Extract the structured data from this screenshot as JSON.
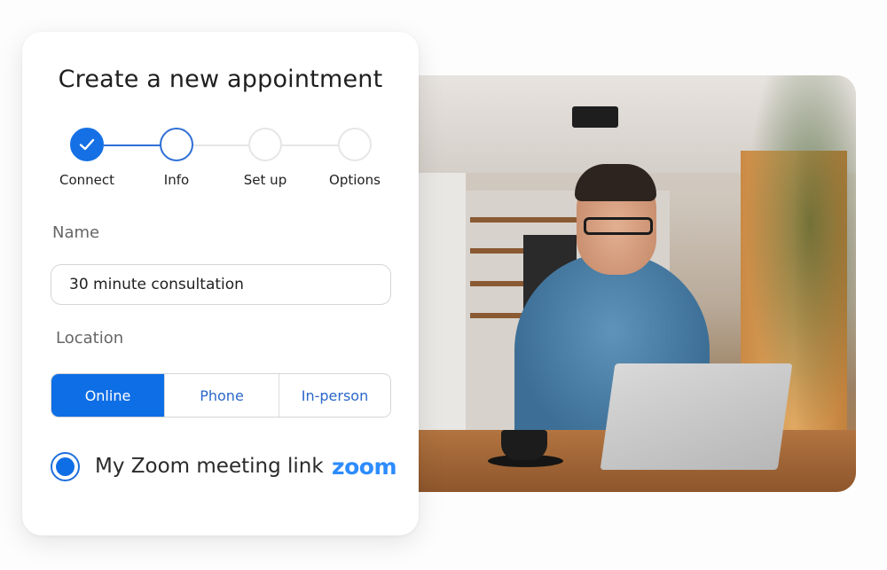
{
  "card": {
    "title": "Create a new appointment",
    "stepper": {
      "steps": [
        {
          "label": "Connect",
          "state": "complete"
        },
        {
          "label": "Info",
          "state": "current"
        },
        {
          "label": "Set up",
          "state": "upcoming"
        },
        {
          "label": "Options",
          "state": "upcoming"
        }
      ]
    },
    "name_field": {
      "label": "Name",
      "value": "30 minute consultation"
    },
    "location": {
      "label": "Location",
      "options": [
        {
          "label": "Online",
          "selected": true
        },
        {
          "label": "Phone",
          "selected": false
        },
        {
          "label": "In-person",
          "selected": false
        }
      ]
    },
    "meeting_option": {
      "label": "My Zoom meeting link",
      "selected": true,
      "provider_logo_text": "zoom"
    }
  },
  "photo": {
    "description": "Smiling man with glasses in denim shirt on video call at laptop"
  },
  "colors": {
    "accent": "#0e6ee6",
    "zoom_brand": "#2d8cff",
    "text_primary": "#1f1f1f",
    "text_muted": "#666666"
  }
}
